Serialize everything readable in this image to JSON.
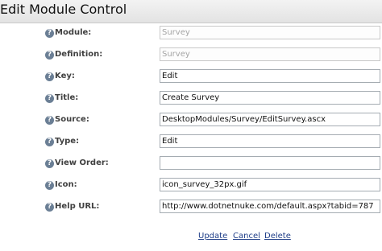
{
  "header": {
    "title": "Edit Module Control"
  },
  "form": {
    "fields": [
      {
        "label": "Module:",
        "value": "Survey",
        "disabled": true
      },
      {
        "label": "Definition:",
        "value": "Survey",
        "disabled": true
      },
      {
        "label": "Key:",
        "value": "Edit",
        "disabled": false
      },
      {
        "label": "Title:",
        "value": "Create Survey",
        "disabled": false
      },
      {
        "label": "Source:",
        "value": "DesktopModules/Survey/EditSurvey.ascx",
        "disabled": false
      },
      {
        "label": "Type:",
        "value": "Edit",
        "disabled": false
      },
      {
        "label": "View Order:",
        "value": "",
        "disabled": false
      },
      {
        "label": "Icon:",
        "value": "icon_survey_32px.gif",
        "disabled": false
      },
      {
        "label": "Help URL:",
        "value": "http://www.dotnetnuke.com/default.aspx?tabid=787",
        "disabled": false
      }
    ],
    "help_icon": "help-question-icon",
    "help_glyph": "?"
  },
  "actions": {
    "update": "Update",
    "cancel": "Cancel",
    "delete": "Delete"
  },
  "colors": {
    "link": "#1f3e88",
    "label": "#404040",
    "icon": "#6b7f95"
  }
}
